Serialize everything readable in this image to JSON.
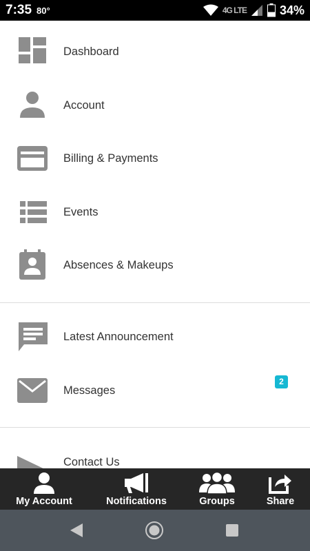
{
  "status_bar": {
    "time": "7:35",
    "temperature": "80°",
    "network": "4G LTE",
    "battery": "34%",
    "icons": [
      "wifi-icon",
      "signal-icon",
      "battery-icon"
    ]
  },
  "menu": {
    "items": [
      {
        "label": "Dashboard",
        "icon": "dashboard-icon"
      },
      {
        "label": "Account",
        "icon": "person-icon"
      },
      {
        "label": "Billing & Payments",
        "icon": "credit-card-icon"
      },
      {
        "label": "Events",
        "icon": "list-icon"
      },
      {
        "label": "Absences & Makeups",
        "icon": "calendar-person-icon"
      },
      {
        "label": "Latest Announcement",
        "icon": "announcement-icon"
      },
      {
        "label": "Messages",
        "icon": "envelope-icon",
        "badge": "2"
      },
      {
        "label": "Contact Us",
        "icon": "send-icon"
      }
    ]
  },
  "tab_bar": {
    "tabs": [
      {
        "label": "My Account",
        "icon": "user-icon"
      },
      {
        "label": "Notifications",
        "icon": "megaphone-icon"
      },
      {
        "label": "Groups",
        "icon": "group-icon"
      },
      {
        "label": "Share",
        "icon": "share-icon"
      }
    ]
  },
  "nav_bar": {
    "buttons": [
      "back-icon",
      "home-icon",
      "recents-icon"
    ]
  },
  "colors": {
    "icon_gray": "#8d8d8d",
    "badge": "#16b8d3",
    "tab_bar_bg": "#262626",
    "nav_bar_bg": "#4e555c"
  }
}
